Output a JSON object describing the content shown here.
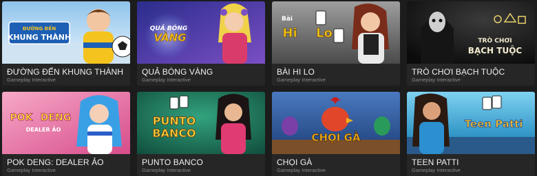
{
  "games": [
    {
      "title": "ĐƯỜNG ĐẾN KHUNG THÀNH",
      "provider": "Gameplay Interactive",
      "logo_lines": [
        "ĐƯỜNG ĐẾN",
        "KHUNG THÀNH"
      ],
      "colors": {
        "bg1": "#8fc3ec",
        "bg2": "#e7f3fb",
        "accent": "#1d5fb4"
      }
    },
    {
      "title": "QUẢ BÓNG VÀNG",
      "provider": "Gameplay Interactive",
      "logo_lines": [
        "QUẢ BÓNG",
        "VÀNG"
      ],
      "colors": {
        "bg1": "#2a2d8c",
        "bg2": "#7b4fc4",
        "accent": "#f6c321"
      }
    },
    {
      "title": "BÀI HI LO",
      "provider": "Gameplay Interactive",
      "logo_lines": [
        "Bài",
        "Hi",
        "Lo"
      ],
      "colors": {
        "bg1": "#5a5a5a",
        "bg2": "#9e9e9e",
        "accent": "#f2c21a"
      }
    },
    {
      "title": "TRÒ CHƠI BẠCH TUỘC",
      "provider": "Gameplay Interactive",
      "logo_lines": [
        "TRÒ CHƠI",
        "BẠCH TUỘC"
      ],
      "colors": {
        "bg1": "#0b0b0b",
        "bg2": "#2a2a2a",
        "accent": "#e9d26a"
      }
    },
    {
      "title": "POK DENG: DEALER ẢO",
      "provider": "Gameplay Interactive",
      "logo_lines": [
        "POK",
        "DENG",
        "DEALER ẢO"
      ],
      "colors": {
        "bg1": "#d74c8a",
        "bg2": "#f6a9c8",
        "accent": "#ffe23a"
      }
    },
    {
      "title": "PUNTO BANCO",
      "provider": "Gameplay Interactive",
      "logo_lines": [
        "PUNTO",
        "BANCO"
      ],
      "colors": {
        "bg1": "#0f6a52",
        "bg2": "#33a37e",
        "accent": "#f7d23a"
      }
    },
    {
      "title": "CHỌI GÀ",
      "provider": "Gameplay Interactive",
      "logo_lines": [
        "CHỌI GÀ"
      ],
      "colors": {
        "bg1": "#1e3f78",
        "bg2": "#4a79c0",
        "accent": "#f2b21c"
      }
    },
    {
      "title": "TEEN PATTI",
      "provider": "Gameplay Interactive",
      "logo_lines": [
        "Teen Patti"
      ],
      "colors": {
        "bg1": "#0f7bb5",
        "bg2": "#7fd2f0",
        "accent": "#f6c330"
      }
    }
  ]
}
